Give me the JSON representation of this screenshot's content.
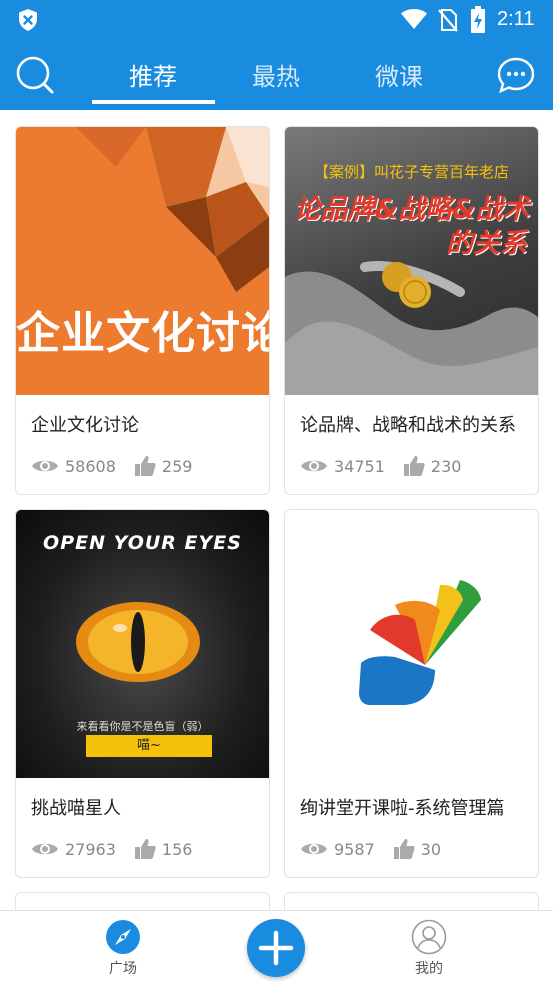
{
  "status_bar": {
    "time": "2:11"
  },
  "tabs": [
    {
      "label": "推荐",
      "active": true
    },
    {
      "label": "最热",
      "active": false
    },
    {
      "label": "微课",
      "active": false
    }
  ],
  "cards": [
    {
      "title": "企业文化讨论",
      "views": "58608",
      "likes": "259",
      "image_text": "企业文化讨论"
    },
    {
      "title": "论品牌、战略和战术的关系",
      "views": "34751",
      "likes": "230",
      "image_line1": "【案例】叫花子专营百年老店",
      "image_line2": "论品牌&战略&战术",
      "image_line3": "的关系"
    },
    {
      "title": "挑战喵星人",
      "views": "27963",
      "likes": "156",
      "image_heading": "OPEN YOUR EYES",
      "image_caption": "来看看你是不是色盲（弱）",
      "image_button": "喵~"
    },
    {
      "title": "绚讲堂开课啦-系统管理篇",
      "views": "9587",
      "likes": "30"
    }
  ],
  "bottom_nav": {
    "plaza_label": "广场",
    "mine_label": "我的"
  },
  "colors": {
    "brand": "#1a8ce0",
    "orange": "#ec7a2f"
  }
}
